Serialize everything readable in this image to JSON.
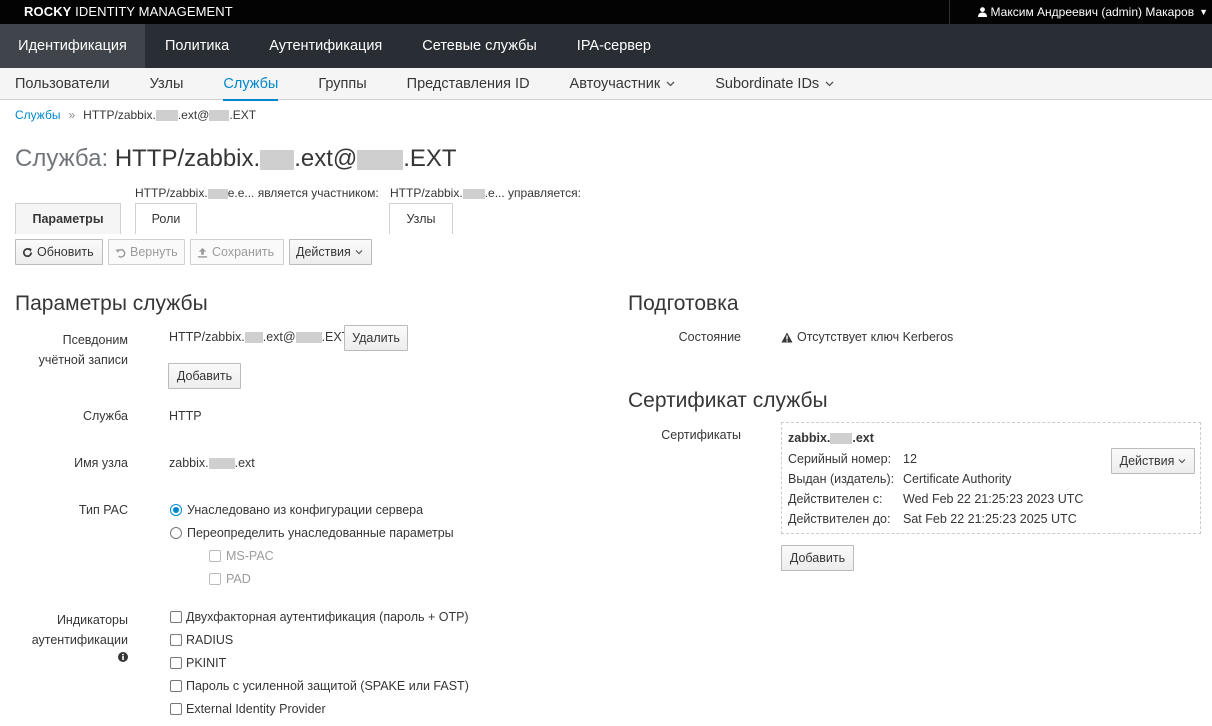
{
  "topbar": {
    "brand_bold": "ROCKY",
    "brand_rest": " IDENTITY MANAGEMENT",
    "user": "Максим Андреевич (admin) Макаров"
  },
  "mainnav": [
    {
      "label": "Идентификация",
      "active": true
    },
    {
      "label": "Политика"
    },
    {
      "label": "Аутентификация"
    },
    {
      "label": "Сетевые службы"
    },
    {
      "label": "IPA-сервер"
    }
  ],
  "subnav": [
    {
      "label": "Пользователи"
    },
    {
      "label": "Узлы"
    },
    {
      "label": "Службы",
      "active": true
    },
    {
      "label": "Группы"
    },
    {
      "label": "Представления ID"
    },
    {
      "label": "Автоучастник",
      "dropdown": true
    },
    {
      "label": "Subordinate IDs",
      "dropdown": true
    }
  ],
  "breadcrumb": {
    "link": "Службы",
    "sep": "»",
    "current_a": "HTTP/zabbix.",
    "current_b": ".ext@",
    "current_c": ".EXT"
  },
  "title": {
    "prefix": "Служба:",
    "a": "HTTP/zabbix.",
    "b": ".ext@",
    "c": ".EXT"
  },
  "facets": {
    "member_label_a": "HTTP/zabbix.",
    "member_label_b": "e.e... является участником:",
    "managed_label_a": "HTTP/zabbix.",
    "managed_label_b": ".e... управляется:",
    "params": "Параметры",
    "roles": "Роли",
    "hosts": "Узлы"
  },
  "actions": {
    "refresh": "Обновить",
    "revert": "Вернуть",
    "save": "Сохранить",
    "actions": "Действия"
  },
  "settings": {
    "title": "Параметры службы",
    "alias_label": "Псевдоним учётной записи",
    "alias_a": "HTTP/zabbix.",
    "alias_b": ".ext@",
    "alias_c": ".EXT",
    "delete": "Удалить",
    "add": "Добавить",
    "service_label": "Служба",
    "service_value": "HTTP",
    "host_label": "Имя узла",
    "host_a": "zabbix.",
    "host_b": ".ext",
    "pac_label": "Тип PAC",
    "pac_inherit": "Унаследовано из конфигурации сервера",
    "pac_override": "Переопределить унаследованные параметры",
    "ms_pac": "MS-PAC",
    "pad": "PAD",
    "auth_label": "Индикаторы аутентификации",
    "auth_opts": [
      "Двухфакторная аутентификация (пароль + OTP)",
      "RADIUS",
      "PKINIT",
      "Пароль с усиленной защитой (SPAKE или FAST)",
      "External Identity Provider"
    ]
  },
  "provisioning": {
    "title": "Подготовка",
    "state_label": "Состояние",
    "state_value": "Отсутствует ключ Kerberos"
  },
  "certificate": {
    "title": "Сертификат службы",
    "label": "Сертификаты",
    "name_a": "zabbix.",
    "name_b": ".ext",
    "serial_label": "Серийный номер:",
    "serial_value": "12",
    "issuer_label": "Выдан (издатель):",
    "issuer_value": "Certificate Authority",
    "valid_from_label": "Действителен с:",
    "valid_from_value": "Wed Feb 22 21:25:23 2023 UTC",
    "valid_to_label": "Действителен до:",
    "valid_to_value": "Sat Feb 22 21:25:23 2025 UTC",
    "actions": "Действия",
    "add": "Добавить"
  },
  "colors": {
    "accent": "#0088ce",
    "nav_dark": "#292e34",
    "topbar": "#030303"
  }
}
